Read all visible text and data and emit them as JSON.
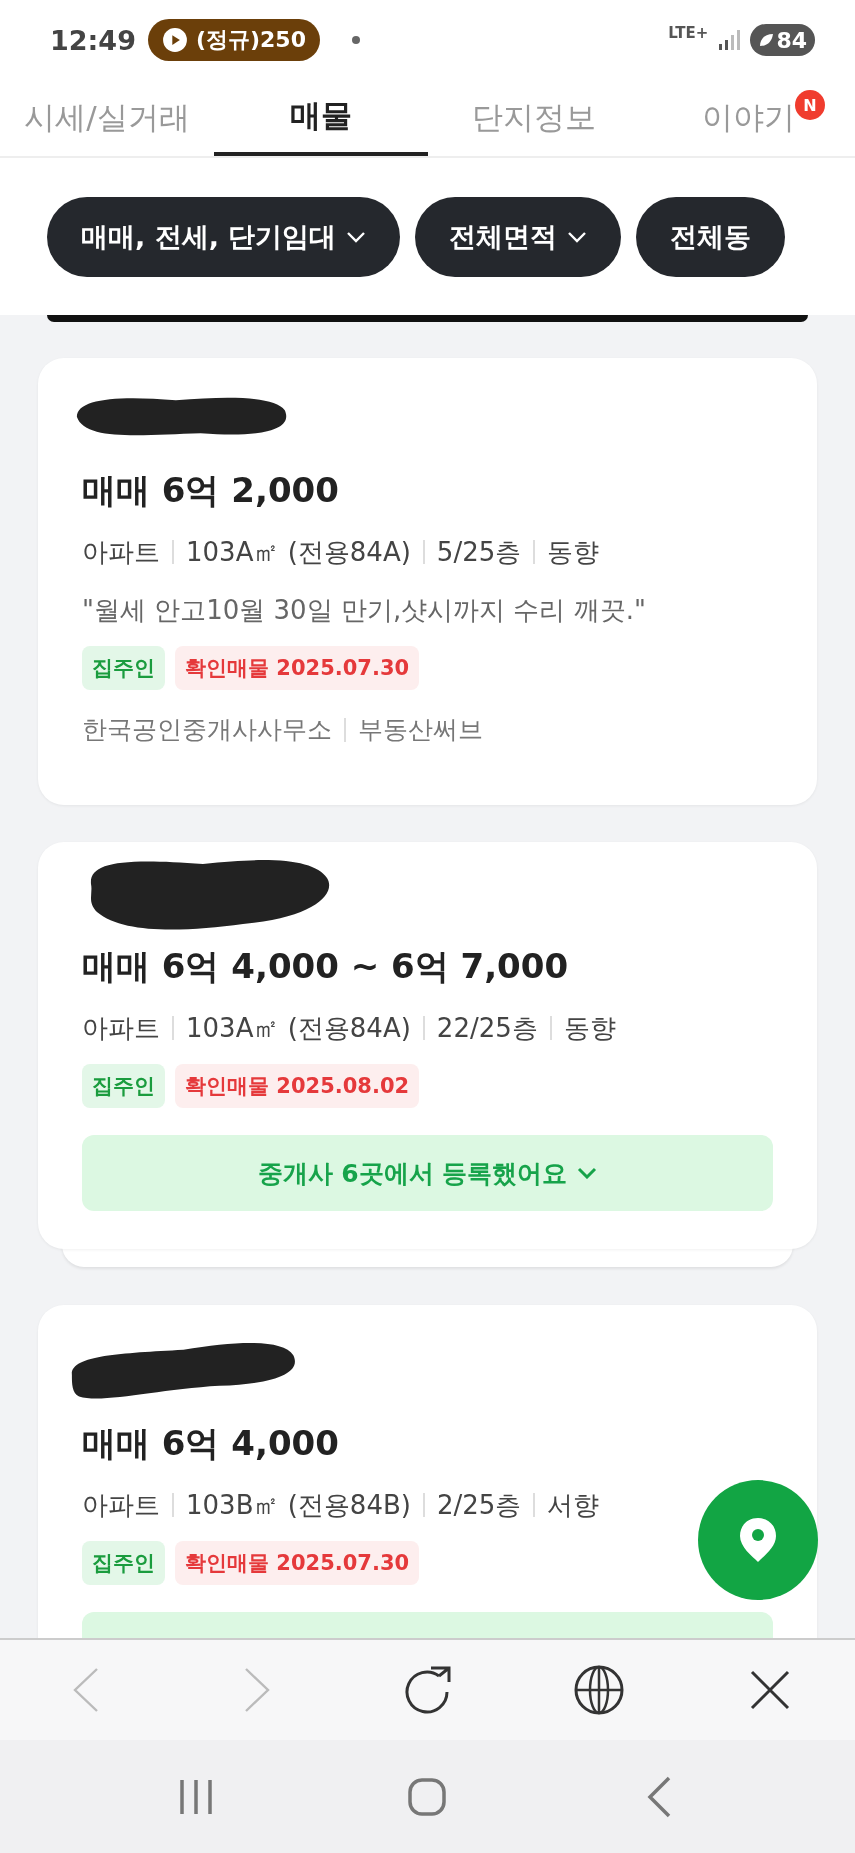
{
  "status_bar": {
    "time": "12:49",
    "media_pill": "(정규)250",
    "network": "LTE+",
    "battery": "84"
  },
  "tabs": [
    {
      "label": "시세/실거래",
      "selected": false
    },
    {
      "label": "매물",
      "selected": true
    },
    {
      "label": "단지정보",
      "selected": false
    },
    {
      "label": "이야기",
      "selected": false,
      "badge": "N"
    }
  ],
  "filters": [
    {
      "label": "매매, 전세, 단기임대",
      "caret": true
    },
    {
      "label": "전체면적",
      "caret": true
    },
    {
      "label": "전체동",
      "caret": false
    }
  ],
  "listings": [
    {
      "price": "매매 6억 2,000",
      "specs": [
        "아파트",
        "103A㎡ (전용84A)",
        "5/25층",
        "동향"
      ],
      "note": "\"월세 안고10월 30일 만기,샷시까지 수리 깨끗.\"",
      "tags": [
        {
          "text": "집주인",
          "kind": "owner"
        },
        {
          "text": "확인매물 2025.07.30",
          "kind": "verified"
        }
      ],
      "agencies": [
        "한국공인중개사사무소",
        "부동산써브"
      ],
      "stacked": false
    },
    {
      "price": "매매 6억 4,000 ~ 6억 7,000",
      "specs": [
        "아파트",
        "103A㎡ (전용84A)",
        "22/25층",
        "동향"
      ],
      "tags": [
        {
          "text": "집주인",
          "kind": "owner"
        },
        {
          "text": "확인매물 2025.08.02",
          "kind": "verified"
        }
      ],
      "agents_button": "중개사 6곳에서 등록했어요",
      "stacked": true
    },
    {
      "price": "매매 6억 4,000",
      "specs": [
        "아파트",
        "103B㎡ (전용84B)",
        "2/25층",
        "서향"
      ],
      "tags": [
        {
          "text": "집주인",
          "kind": "owner"
        },
        {
          "text": "확인매물 2025.07.30",
          "kind": "verified"
        }
      ],
      "agents_button_cut": true
    }
  ],
  "browser_toolbar": {
    "back_disabled": true,
    "forward_disabled": true
  }
}
